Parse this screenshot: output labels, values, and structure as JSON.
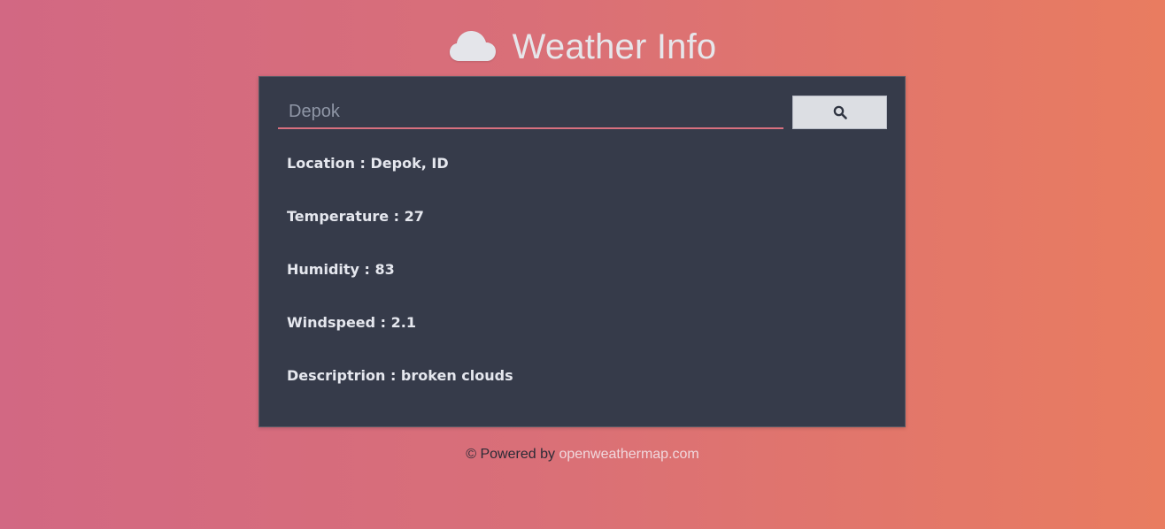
{
  "header": {
    "icon": "cloud-icon",
    "title": "Weather Info"
  },
  "search": {
    "placeholder": "Depok",
    "value": "",
    "button_icon": "search-icon"
  },
  "weather": {
    "location": "Location : Depok, ID",
    "temperature": "Temperature : 27",
    "humidity": "Humidity : 83",
    "windspeed": "Windspeed : 2.1",
    "description": "Descriptrion : broken clouds"
  },
  "footer": {
    "prefix": "© Powered by",
    "link_text": "openweathermap.com"
  },
  "colors": {
    "background_start": "#d26883",
    "background_end": "#e97c60",
    "card": "#363b4a",
    "accent": "#d8707f",
    "text_light": "#e5e7ee"
  }
}
